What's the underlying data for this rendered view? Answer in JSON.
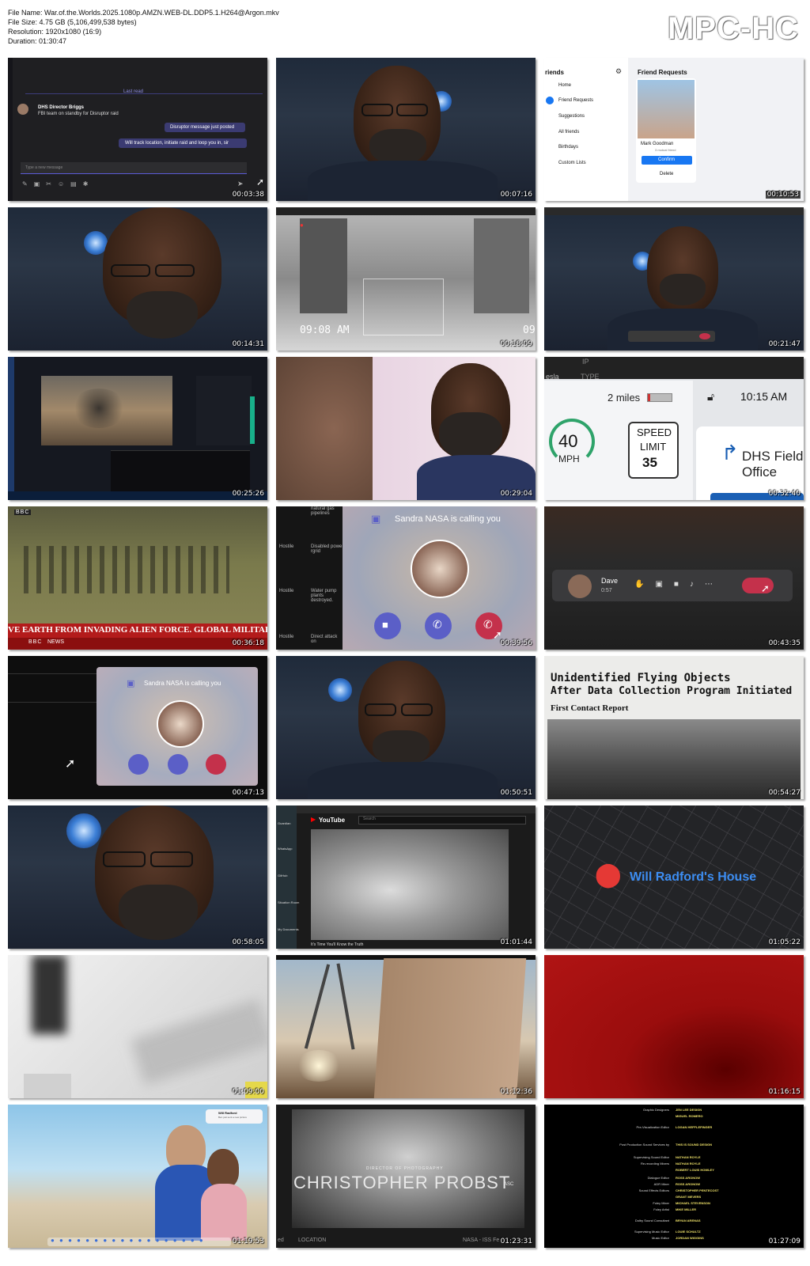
{
  "header": {
    "file_name": "File Name: War.of.the.Worlds.2025.1080p.AMZN.WEB-DL.DDP5.1.H264@Argon.mkv",
    "file_size": "File Size: 4.75 GB (5,106,499,538 bytes)",
    "resolution": "Resolution: 1920x1080 (16:9)",
    "duration": "Duration: 01:30:47"
  },
  "brand": "MPC-HC",
  "thumbs": [
    {
      "ts": "00:03:38",
      "last_read": "Last read",
      "sender": "DHS Director Briggs",
      "sender_msg": "FBI team on standby for Disruptor raid",
      "msg1": "Disruptor message just posted",
      "msg2": "Will track location, initiate raid and loop you in, sir",
      "input_placeholder": "Type a new message"
    },
    {
      "ts": "00:07:16"
    },
    {
      "ts": "00:10:53",
      "friends_title": "riends",
      "friend_requests_title": "Friend Requests",
      "menu": [
        "Home",
        "Friend Requests",
        "Suggestions",
        "All friends",
        "Birthdays",
        "Custom Lists"
      ],
      "requester": "Mark Goodman",
      "mutual": "3 mutual friend",
      "confirm": "Confirm",
      "delete": "Delete"
    },
    {
      "ts": "00:14:31"
    },
    {
      "ts": "00:18:09",
      "cam_time": "09:08 AM",
      "cam_edge": "09"
    },
    {
      "ts": "00:21:47"
    },
    {
      "ts": "00:25:26"
    },
    {
      "ts": "00:29:04"
    },
    {
      "ts": "00:32:40",
      "top_left": "esla",
      "top_mid": "IP",
      "top_type": "TYPE",
      "distance": "2 miles",
      "clock": "10:15 AM",
      "speed": "40",
      "speed_unit": "MPH",
      "limit_label1": "SPEED",
      "limit_label2": "LIMIT",
      "limit_value": "35",
      "dest1": "DHS Field",
      "dest2": "Office"
    },
    {
      "ts": "00:36:18",
      "ticker": "VE EARTH FROM INVADING ALIEN FORCE. GLOBAL MILITAR",
      "network_top": "BBC",
      "network_bottom": "NEWS"
    },
    {
      "ts": "00:39:56",
      "caller": "Sandra NASA is calling you",
      "table": [
        [
          "",
          "natural gas pipelines"
        ],
        [
          "Hostile",
          "Disabled powe rgrid"
        ],
        [
          "Hostile",
          "Water pump plants destroyed."
        ],
        [
          "Hostile",
          "Direct attack on"
        ]
      ]
    },
    {
      "ts": "00:43:35",
      "call_name": "Dave",
      "call_time": "0:57"
    },
    {
      "ts": "00:47:13",
      "caller": "Sandra NASA is calling you"
    },
    {
      "ts": "00:50:51"
    },
    {
      "ts": "00:54:27",
      "headline1": "Unidentified Flying Objects",
      "headline2": "After Data Collection Program Initiated",
      "subhead": "First Contact Report"
    },
    {
      "ts": "00:58:05"
    },
    {
      "ts": "01:01:44",
      "yt": "YouTube",
      "search": "Search",
      "bottom_caption": "It's Time You'll Know the Truth",
      "side_labels": [
        "Guardian",
        "WhatsApp",
        "GitHub",
        "Situation Room",
        "My Documents"
      ]
    },
    {
      "ts": "01:05:22",
      "place": "Will Radford's House"
    },
    {
      "ts": "01:09:00"
    },
    {
      "ts": "01:12:36"
    },
    {
      "ts": "01:16:15"
    },
    {
      "ts": "01:19:53",
      "notif_title": "Will Radford",
      "notif_sub": "Ben just sent a new picture"
    },
    {
      "ts": "01:23:31",
      "role": "DIRECTOR OF PHOTOGRAPHY",
      "name": "CHRISTOPHER PROBST",
      "suffix": "ASC",
      "bottom_left": "ed",
      "location": "LOCATION",
      "bottom_right": "NASA - ISS Fe"
    },
    {
      "ts": "01:27:09",
      "credits": [
        [
          "Graphic Designers",
          "JEN LEE DESIGN"
        ],
        [
          "",
          "MIGUEL ROMERO"
        ],
        [
          "Pre-Visualization Editor",
          "LOGAN HEFFLEFINGER"
        ],
        [
          "Post Production Sound Services by",
          "THIS IS SOUND DESIGN"
        ],
        [
          "Supervising Sound Editor",
          "NATHAN ROYLE"
        ],
        [
          "Re-recording Mixers",
          "NATHAN ROYLE"
        ],
        [
          "",
          "ROBERT LOUIS HOWLEY"
        ],
        [
          "Dialogue Editor",
          "ROSS ARONOW"
        ],
        [
          "ADR Mixer",
          "ROSS ARONOW"
        ],
        [
          "Sound Effects Editors",
          "CHRISTOPHER PENTECOST"
        ],
        [
          "",
          "GRANT MEVERS"
        ],
        [
          "Foley Mixer",
          "MICHAEL STEVENSON"
        ],
        [
          "Foley Artist",
          "MIKE MILLER"
        ],
        [
          "Dolby Sound Consultant",
          "BRYAN ARENAS"
        ],
        [
          "Supervising Music Editor",
          "LOUIE SCHULTZ"
        ],
        [
          "Music Editor",
          "JORDAN WIGGINS"
        ]
      ]
    }
  ]
}
